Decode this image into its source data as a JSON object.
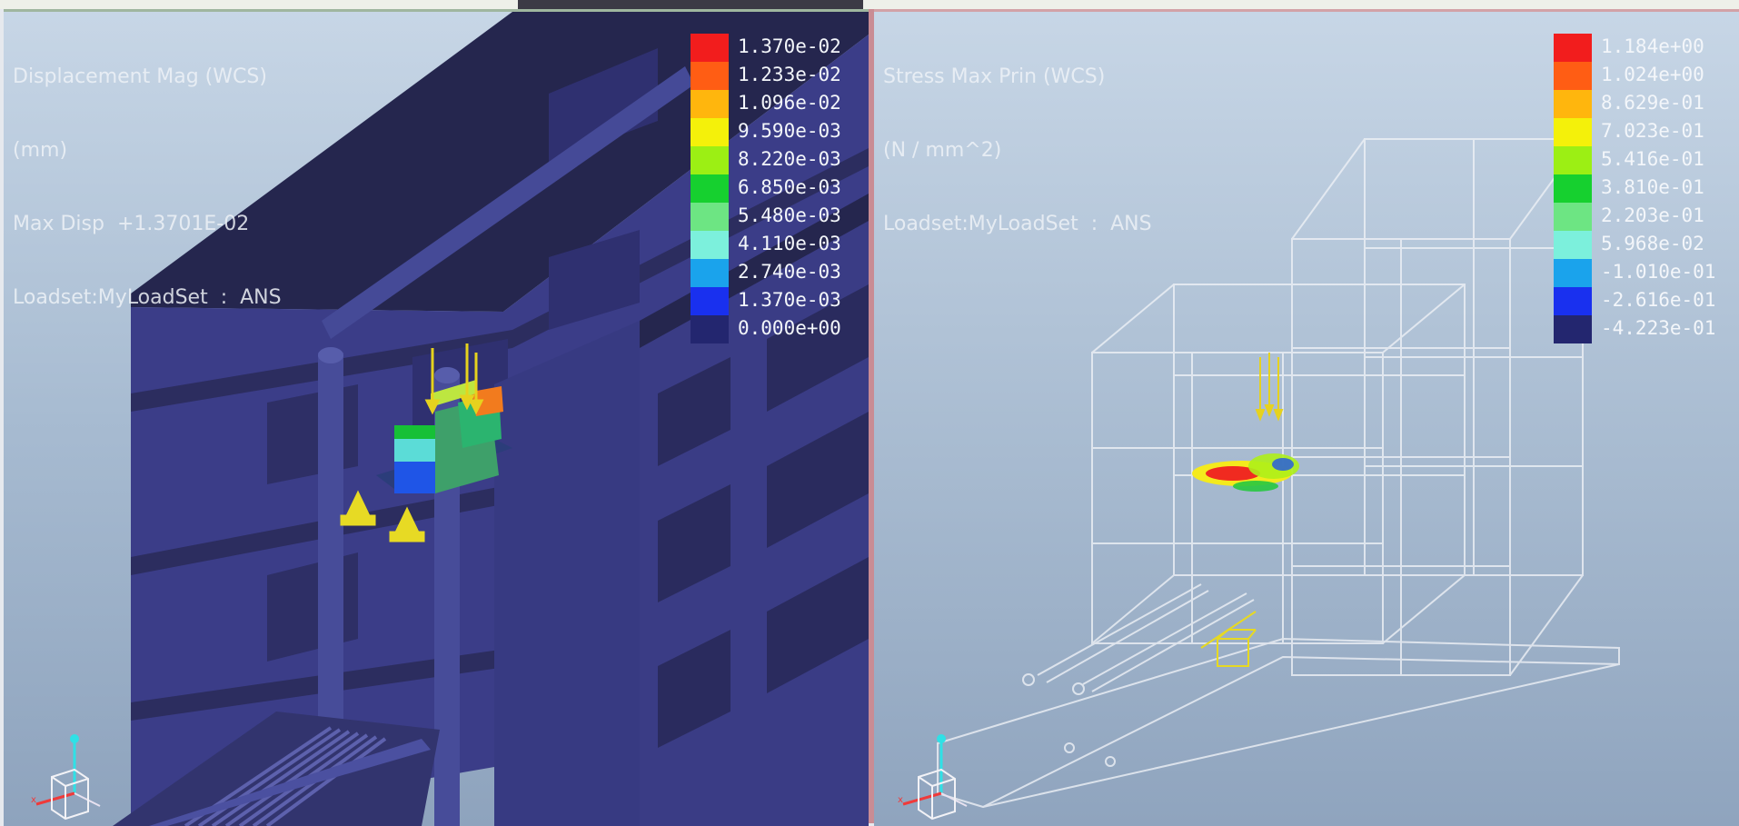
{
  "left_view": {
    "title": "Displacement Mag (WCS)",
    "units": "(mm)",
    "max_label": "Max Disp  +1.3701E-02",
    "loadset": "Loadset:MyLoadSet  :  ANS",
    "legend": [
      {
        "label": "1.370e-02",
        "color": "#f21d1d"
      },
      {
        "label": "1.233e-02",
        "color": "#ff5d14"
      },
      {
        "label": "1.096e-02",
        "color": "#ffb60d"
      },
      {
        "label": "9.590e-03",
        "color": "#f4f10a"
      },
      {
        "label": "8.220e-03",
        "color": "#9cef14"
      },
      {
        "label": "6.850e-03",
        "color": "#16d02f"
      },
      {
        "label": "5.480e-03",
        "color": "#6de583"
      },
      {
        "label": "4.110e-03",
        "color": "#7cf0dc"
      },
      {
        "label": "2.740e-03",
        "color": "#1aa3ec"
      },
      {
        "label": "1.370e-03",
        "color": "#1930ef"
      },
      {
        "label": "0.000e+00",
        "color": "#23266f"
      }
    ]
  },
  "right_view": {
    "title": "Stress Max Prin (WCS)",
    "units": "(N / mm^2)",
    "loadset": "Loadset:MyLoadSet  :  ANS",
    "legend": [
      {
        "label": "1.184e+00",
        "color": "#f21d1d"
      },
      {
        "label": "1.024e+00",
        "color": "#ff5d14"
      },
      {
        "label": "8.629e-01",
        "color": "#ffb60d"
      },
      {
        "label": "7.023e-01",
        "color": "#f4f10a"
      },
      {
        "label": "5.416e-01",
        "color": "#9cef14"
      },
      {
        "label": "3.810e-01",
        "color": "#16d02f"
      },
      {
        "label": "2.203e-01",
        "color": "#6de583"
      },
      {
        "label": "5.968e-02",
        "color": "#7cf0dc"
      },
      {
        "label": "-1.010e-01",
        "color": "#1aa3ec"
      },
      {
        "label": "-2.616e-01",
        "color": "#1930ef"
      },
      {
        "label": "-4.223e-01",
        "color": "#23266f"
      }
    ]
  },
  "colors": {
    "model_fill": "#3c3f8c",
    "model_dark": "#24264f",
    "wire": "#eef1f6",
    "background_top": "#c7d6e6",
    "background_bottom": "#8ea3bd"
  },
  "icons": {
    "triad": "coordinate-triad-icon",
    "load": "load-arrow-icon",
    "constraint": "constraint-icon"
  }
}
